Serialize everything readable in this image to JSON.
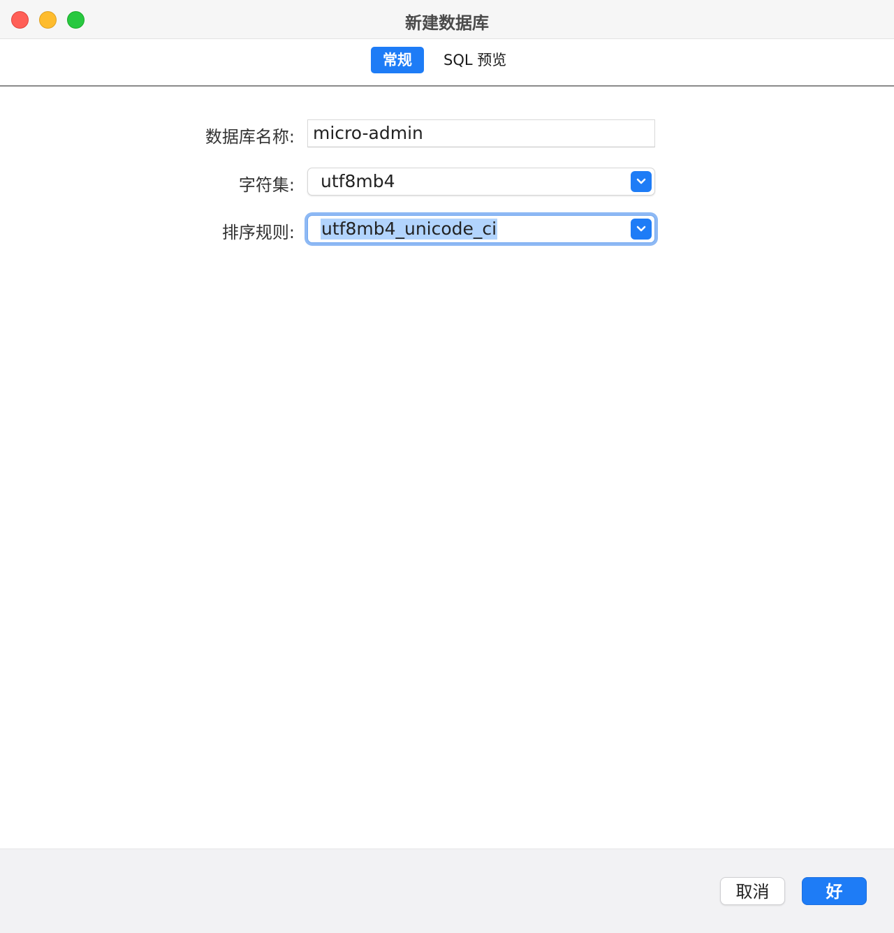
{
  "window": {
    "title": "新建数据库"
  },
  "tabs": [
    {
      "label": "常规",
      "active": true
    },
    {
      "label": "SQL 预览",
      "active": false
    }
  ],
  "form": {
    "db_name": {
      "label": "数据库名称:",
      "value": "micro-admin"
    },
    "charset": {
      "label": "字符集:",
      "value": "utf8mb4"
    },
    "collation": {
      "label": "排序规则:",
      "value": "utf8mb4_unicode_ci"
    }
  },
  "footer": {
    "cancel_label": "取消",
    "ok_label": "好"
  },
  "colors": {
    "accent": "#1e7cf6",
    "focus_ring": "#8eb9f4",
    "selection": "#b2d4fd"
  },
  "icons": {
    "close": "close-icon",
    "minimize": "minimize-icon",
    "maximize": "maximize-icon",
    "dropdown": "chevron-down-icon"
  }
}
